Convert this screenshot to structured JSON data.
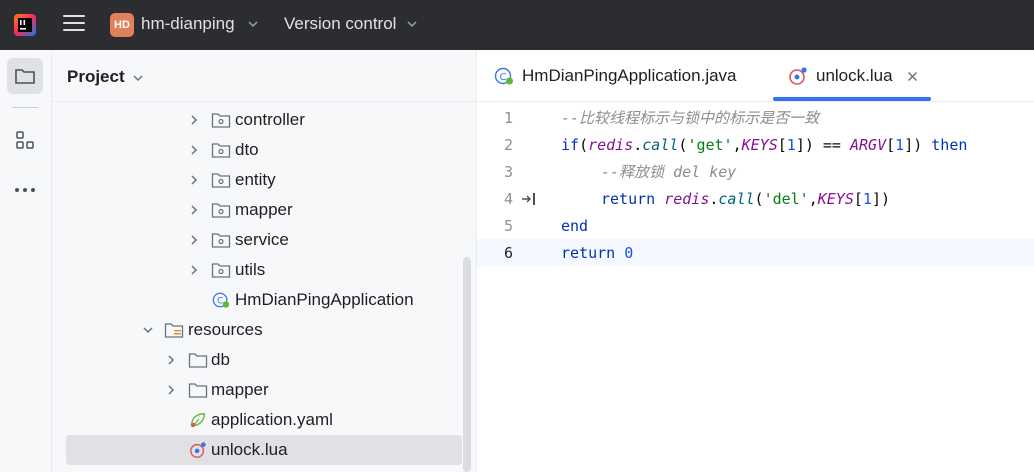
{
  "titlebar": {
    "project_badge": "HD",
    "project_name": "hm-dianping",
    "vcs_label": "Version control"
  },
  "toolstrip": {
    "items": [
      "project",
      "structure",
      "more"
    ]
  },
  "project_panel": {
    "title": "Project",
    "tree": [
      {
        "label": "controller",
        "type": "package"
      },
      {
        "label": "dto",
        "type": "package"
      },
      {
        "label": "entity",
        "type": "package"
      },
      {
        "label": "mapper",
        "type": "package"
      },
      {
        "label": "service",
        "type": "package"
      },
      {
        "label": "utils",
        "type": "package"
      },
      {
        "label": "HmDianPingApplication",
        "type": "spring-class"
      },
      {
        "label": "resources",
        "type": "resources-folder"
      },
      {
        "label": "db",
        "type": "folder"
      },
      {
        "label": "mapper",
        "type": "folder"
      },
      {
        "label": "application.yaml",
        "type": "yaml"
      },
      {
        "label": "unlock.lua",
        "type": "lua",
        "selected": true
      }
    ]
  },
  "editor": {
    "tabs": [
      {
        "label": "HmDianPingApplication.java",
        "active": false
      },
      {
        "label": "unlock.lua",
        "active": true
      }
    ],
    "line_numbers": [
      "1",
      "2",
      "3",
      "4",
      "5",
      "6"
    ],
    "current_line": "6",
    "code": {
      "l1_comment": "--比较线程标示与锁中的标示是否一致",
      "l2_if": "if",
      "l2_p1": "(",
      "l2_redis": "redis",
      "l2_dot": ".",
      "l2_call": "call",
      "l2_p2": "(",
      "l2_get": "'get'",
      "l2_comma": ",",
      "l2_keys": "KEYS",
      "l2_b1": "[",
      "l2_one": "1",
      "l2_b2": "]) == ",
      "l2_argv": "ARGV",
      "l2_b3": "[",
      "l2_one2": "1",
      "l2_b4": "]) ",
      "l2_then": "then",
      "l3_comment": "--释放锁 del key",
      "l4_return": "return",
      "l4_redis": "redis",
      "l4_dot": ".",
      "l4_call": "call",
      "l4_p": "(",
      "l4_del": "'del'",
      "l4_comma": ",",
      "l4_keys": "KEYS",
      "l4_b1": "[",
      "l4_one": "1",
      "l4_b2": "])",
      "l5_end": "end",
      "l6_return": "return",
      "l6_zero": "0"
    }
  }
}
